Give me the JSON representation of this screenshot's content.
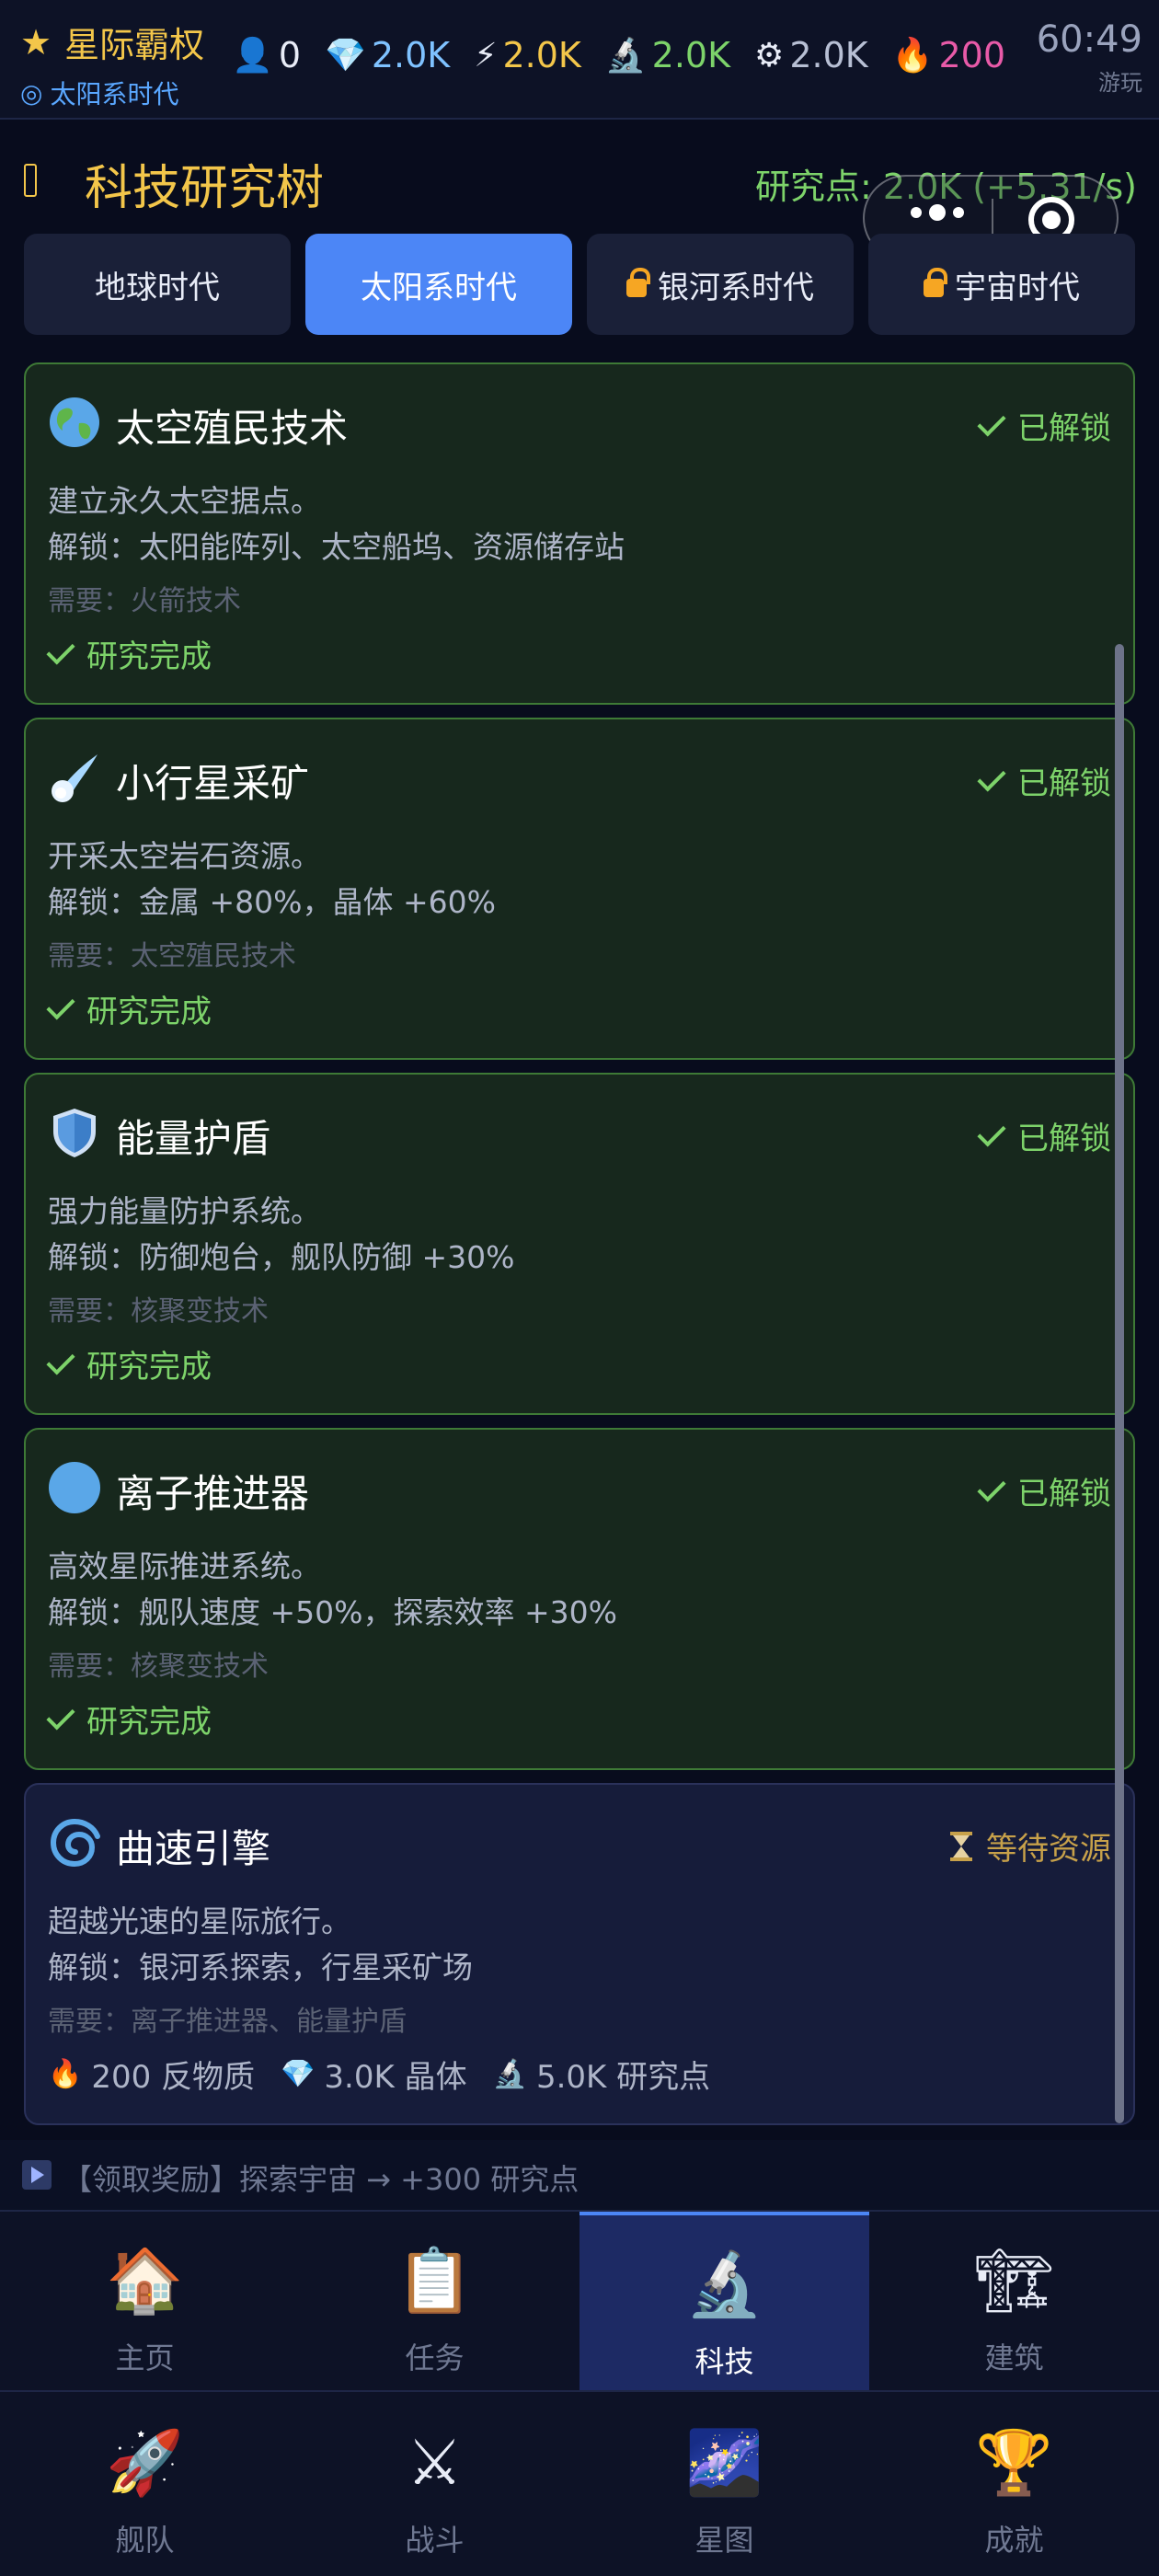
{
  "topbar": {
    "brand_star": "★",
    "brand_title": "星际霸权",
    "era_icon": "◎",
    "era_label": "太阳系时代",
    "resources": [
      {
        "icon": "population-icon",
        "glyph": "👤",
        "value": "0",
        "color": "#e8ecf7"
      },
      {
        "icon": "crystal-icon",
        "glyph": "💎",
        "value": "2.0K",
        "color": "#7fc2ff"
      },
      {
        "icon": "energy-icon",
        "glyph": "⚡",
        "value": "2.0K",
        "color": "#f3c64a"
      },
      {
        "icon": "research-icon",
        "glyph": "🔬",
        "value": "2.0K",
        "color": "#7dd36a"
      },
      {
        "icon": "metal-gear-icon",
        "glyph": "⚙",
        "value": "2.0K",
        "color": "#b7bfd4"
      },
      {
        "icon": "antimatter-fire-icon",
        "glyph": "🔥",
        "value": "200",
        "color": "#e85aa8"
      }
    ],
    "clock_time": "60:49",
    "clock_sub": "游玩"
  },
  "header": {
    "title": "科技研究树",
    "research_points": "研究点: 2.0K (+5.31/s)"
  },
  "tabs": [
    {
      "label": "地球时代",
      "locked": false,
      "active": false
    },
    {
      "label": "太阳系时代",
      "locked": false,
      "active": true
    },
    {
      "label": "银河系时代",
      "locked": true,
      "active": false
    },
    {
      "label": "宇宙时代",
      "locked": true,
      "active": false
    }
  ],
  "cards": [
    {
      "icon": "globe-icon",
      "title": "太空殖民技术",
      "status": "已解锁",
      "desc": "建立永久太空据点。",
      "unlock": "解锁：太阳能阵列、太空船坞、资源储存站",
      "req": "需要：火箭技术",
      "done": "研究完成"
    },
    {
      "icon": "comet-icon",
      "title": "小行星采矿",
      "status": "已解锁",
      "desc": "开采太空岩石资源。",
      "unlock": "解锁：金属 +80%，晶体 +60%",
      "req": "需要：太空殖民技术",
      "done": "研究完成"
    },
    {
      "icon": "shield-icon",
      "title": "能量护盾",
      "status": "已解锁",
      "desc": "强力能量防护系统。",
      "unlock": "解锁：防御炮台，舰队防御 +30%",
      "req": "需要：核聚变技术",
      "done": "研究完成"
    },
    {
      "icon": "blue-circle-icon",
      "title": "离子推进器",
      "status": "已解锁",
      "desc": "高效星际推进系统。",
      "unlock": "解锁：舰队速度 +50%，探索效率 +30%",
      "req": "需要：核聚变技术",
      "done": "研究完成"
    },
    {
      "icon": "cyclone-icon",
      "title": "曲速引擎",
      "status": "等待资源",
      "desc": "超越光速的星际旅行。",
      "unlock": "解锁：银河系探索，行星采矿场",
      "req": "需要：离子推进器、能量护盾",
      "costs": [
        {
          "icon": "fire-icon",
          "glyph": "🔥",
          "text": "200 反物质"
        },
        {
          "icon": "crystal-icon",
          "glyph": "💎",
          "text": "3.0K 晶体"
        },
        {
          "icon": "microscope-icon",
          "glyph": "🔬",
          "text": "5.0K 研究点"
        }
      ]
    }
  ],
  "notice": "【领取奖励】探索宇宙 → +300 研究点",
  "nav": {
    "row1": [
      {
        "icon": "house-icon",
        "glyph": "🏠",
        "label": "主页",
        "active": false
      },
      {
        "icon": "clipboard-icon",
        "glyph": "📋",
        "label": "任务",
        "active": false
      },
      {
        "icon": "microscope-icon",
        "glyph": "🔬",
        "label": "科技",
        "active": true
      },
      {
        "icon": "crane-icon",
        "glyph": "🏗",
        "label": "建筑",
        "active": false
      }
    ],
    "row2": [
      {
        "icon": "rocket-icon",
        "glyph": "🚀",
        "label": "舰队",
        "active": false
      },
      {
        "icon": "crossed-swords-icon",
        "glyph": "⚔",
        "label": "战斗",
        "active": false
      },
      {
        "icon": "starry-night-icon",
        "glyph": "🌌",
        "label": "星图",
        "active": false
      },
      {
        "icon": "trophy-icon",
        "glyph": "🏆",
        "label": "成就",
        "active": false
      }
    ]
  }
}
